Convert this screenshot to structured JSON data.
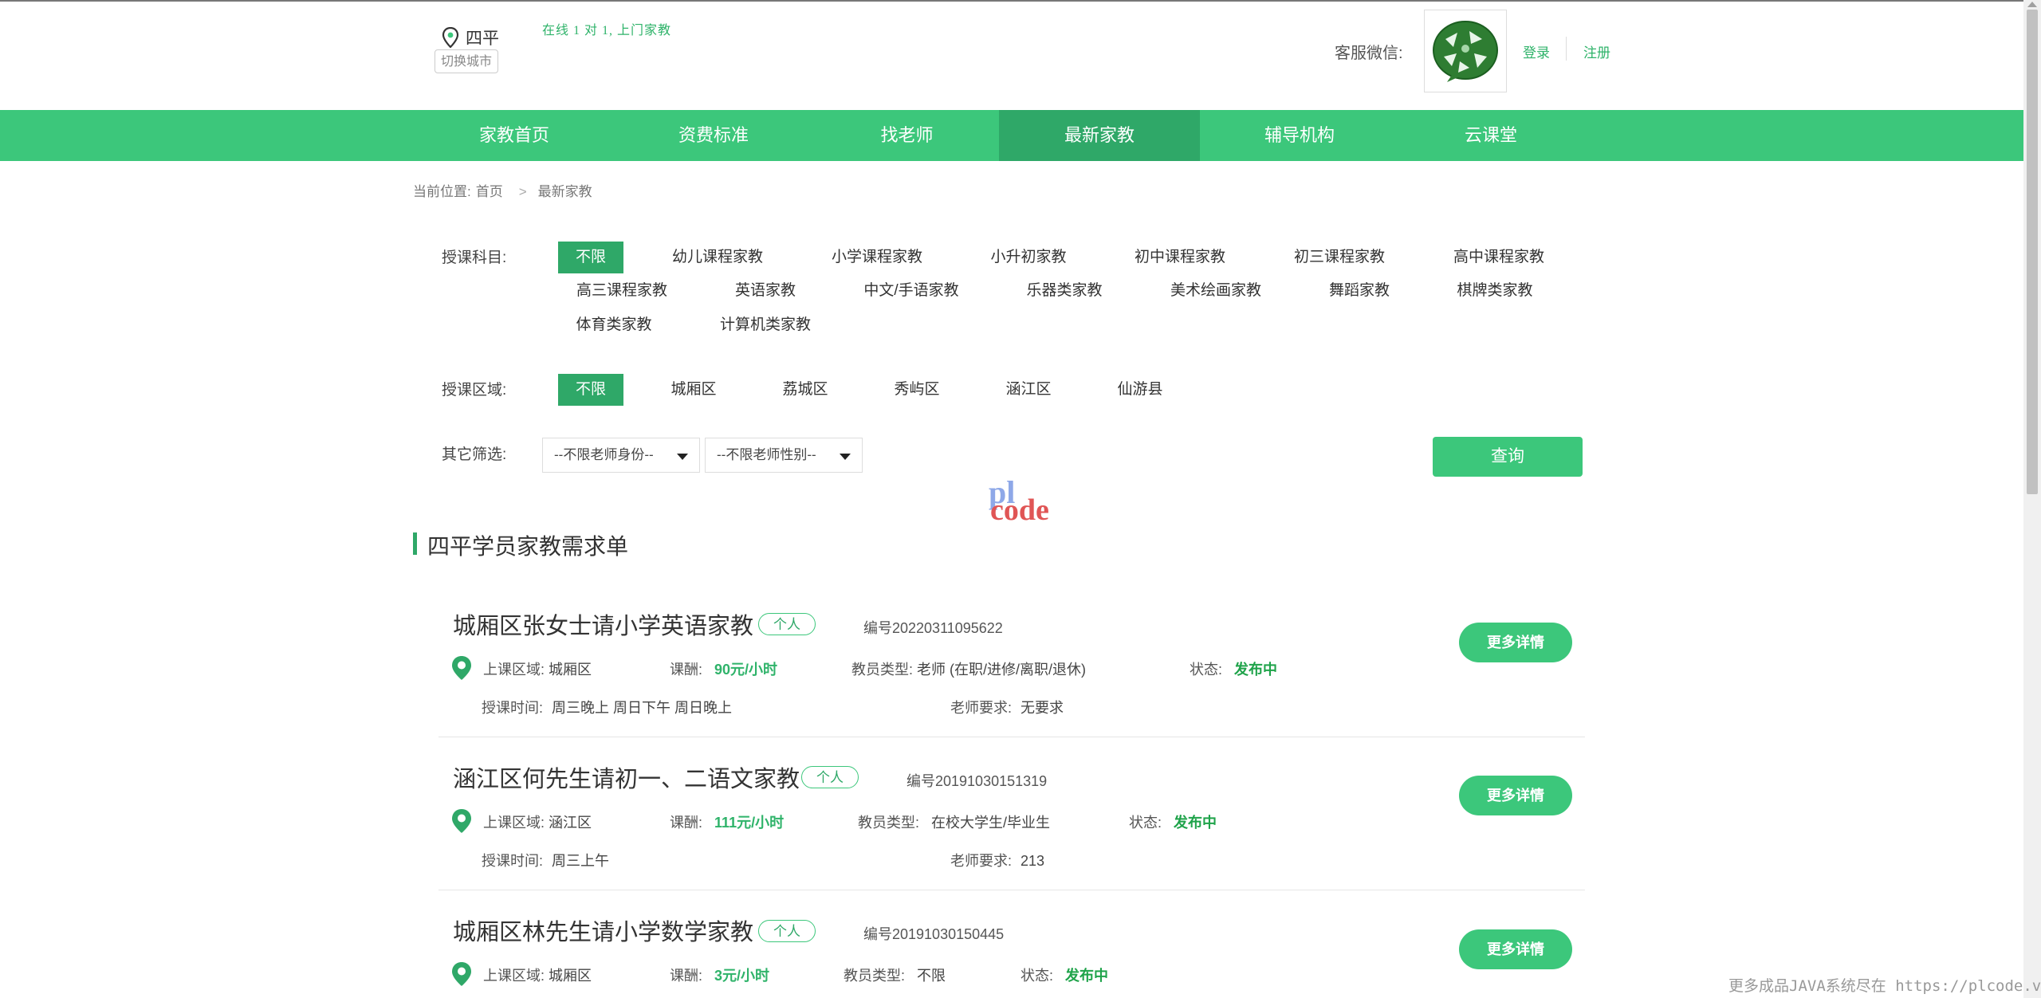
{
  "header": {
    "city": "四平",
    "switch_city": "切换城市",
    "slogan": "在线 1 对 1, 上门家教",
    "service_label": "客服微信:",
    "login": "登录",
    "register": "注册",
    "qr_icon": "wechat-qr-code",
    "location_icon": "location-pin-icon"
  },
  "nav": {
    "items": [
      {
        "label": "家教首页"
      },
      {
        "label": "资费标准"
      },
      {
        "label": "找老师"
      },
      {
        "label": "最新家教"
      },
      {
        "label": "辅导机构"
      },
      {
        "label": "云课堂"
      }
    ],
    "active_index": 3
  },
  "breadcrumb": {
    "prefix": "当前位置:",
    "home": "首页",
    "current": "最新家教"
  },
  "filters": {
    "subject_label": "授课科目:",
    "subjects": [
      "不限",
      "幼儿课程家教",
      "小学课程家教",
      "小升初家教",
      "初中课程家教",
      "初三课程家教",
      "高中课程家教",
      "高三课程家教",
      "英语家教",
      "中文/手语家教",
      "乐器类家教",
      "美术绘画家教",
      "舞蹈家教",
      "棋牌类家教",
      "体育类家教",
      "计算机类家教"
    ],
    "region_label": "授课区域:",
    "regions": [
      "不限",
      "城厢区",
      "荔城区",
      "秀屿区",
      "涵江区",
      "仙游县"
    ],
    "other_label": "其它筛选:",
    "identity_select": "--不限老师身份--",
    "gender_select": "--不限老师性别--",
    "query_button": "查询"
  },
  "watermark": {
    "top": "pl",
    "bottom": "code"
  },
  "section": {
    "title": "四平学员家教需求单"
  },
  "listings": [
    {
      "title": "城厢区张女士请小学英语家教",
      "tag": "个人",
      "number": "编号20220311095622",
      "region_label": "上课区域:",
      "region": "城厢区",
      "pay_label": "课酬:",
      "pay": "90元/小时",
      "teacher_type_label": "教员类型:",
      "teacher_type": "老师 (在职/进修/离职/退休)",
      "status_label": "状态:",
      "status": "发布中",
      "time_label": "授课时间:",
      "time": "周三晚上 周日下午 周日晚上",
      "req_label": "老师要求:",
      "req": "无要求",
      "more": "更多详情"
    },
    {
      "title": "涵江区何先生请初一、二语文家教",
      "tag": "个人",
      "number": "编号20191030151319",
      "region_label": "上课区域:",
      "region": "涵江区",
      "pay_label": "课酬:",
      "pay": "111元/小时",
      "teacher_type_label": "教员类型:",
      "teacher_type": "在校大学生/毕业生",
      "status_label": "状态:",
      "status": "发布中",
      "time_label": "授课时间:",
      "time": "周三上午",
      "req_label": "老师要求:",
      "req": "213",
      "more": "更多详情"
    },
    {
      "title": "城厢区林先生请小学数学家教",
      "tag": "个人",
      "number": "编号20191030150445",
      "region_label": "上课区域:",
      "region": "城厢区",
      "pay_label": "课酬:",
      "pay": "3元/小时",
      "teacher_type_label": "教员类型:",
      "teacher_type": "不限",
      "status_label": "状态:",
      "status": "发布中",
      "more": "更多详情"
    }
  ],
  "footer_note": "更多成品JAVA系统尽在 https://plcode.vip",
  "colors": {
    "brand_green": "#3cc77b",
    "active_green": "#2fa868",
    "status_green": "#1fa34a"
  }
}
